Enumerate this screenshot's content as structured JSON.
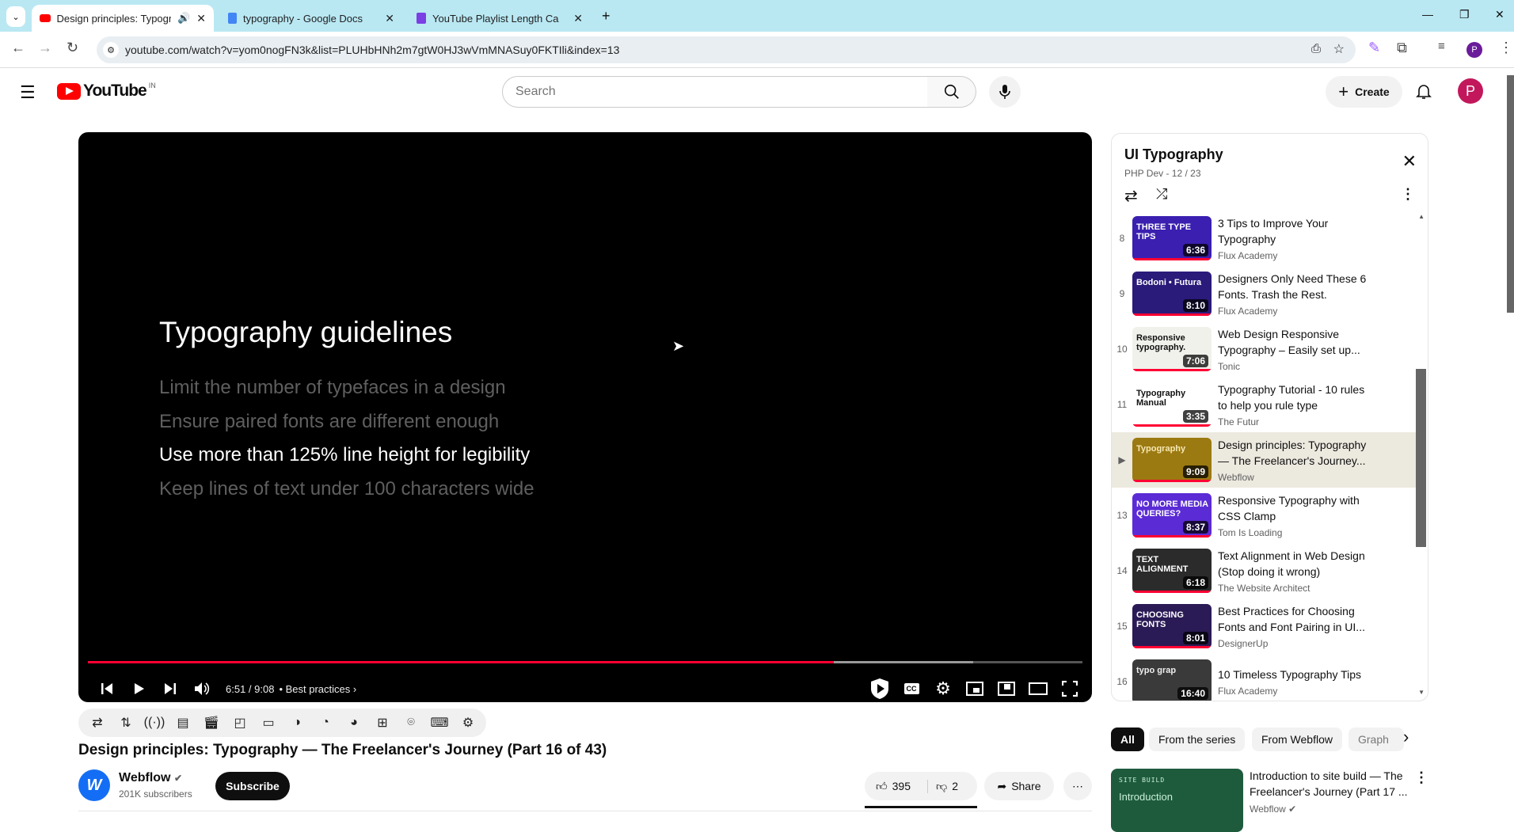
{
  "browser": {
    "tabs": [
      {
        "label": "Design principles: Typograp",
        "icon": "youtube-icon",
        "audio": true,
        "active": true
      },
      {
        "label": "typography - Google Docs",
        "icon": "docs-icon"
      },
      {
        "label": "YouTube Playlist Length Calcula",
        "icon": "calculator-icon"
      }
    ],
    "url": "youtube.com/watch?v=yom0nogFN3k&list=PLUHbHNh2m7gtW0HJ3wVmMNASuy0FKTIli&index=13"
  },
  "header": {
    "logo": "YouTube",
    "region": "IN",
    "search_placeholder": "Search",
    "create_label": "Create",
    "avatar_letter": "P",
    "avatar_color": "#c2185b"
  },
  "player": {
    "slide_title": "Typography guidelines",
    "slide_lines": [
      {
        "text": "Limit the number of typefaces in a design",
        "highlight": false
      },
      {
        "text": "Ensure paired fonts are different enough",
        "highlight": false
      },
      {
        "text": "Use more than 125% line height for legibility",
        "highlight": true
      },
      {
        "text": "Keep lines of text under 100 characters wide",
        "highlight": false
      }
    ],
    "time": "6:51 / 9:08",
    "chapter": "• Best practices",
    "played_fraction": 0.75,
    "buffered_fraction": 0.89,
    "accent": "#ff0033"
  },
  "video": {
    "title": "Design principles: Typography — The Freelancer's Journey (Part 16 of 43)",
    "channel": "Webflow",
    "subscribers": "201K subscribers",
    "subscribe_label": "Subscribe",
    "likes": "395",
    "dislikes": "2",
    "share_label": "Share"
  },
  "playlist": {
    "title": "UI Typography",
    "subtitle": "PHP Dev - 12 / 23",
    "items": [
      {
        "index": "8",
        "title": "3 Tips to Improve Your Typography",
        "channel": "Flux Academy",
        "duration": "6:36",
        "bg": "#3a1fb0",
        "thumb_text": "THREE TYPE TIPS",
        "thumb_color": "#fff"
      },
      {
        "index": "9",
        "title": "Designers Only Need These 6 Fonts. Trash the Rest.",
        "channel": "Flux Academy",
        "duration": "8:10",
        "bg": "#2a1a7a",
        "thumb_text": "Bodoni • Futura",
        "thumb_color": "#fff"
      },
      {
        "index": "10",
        "title": "Web Design Responsive Typography – Easily set up...",
        "channel": "Tonic",
        "duration": "7:06",
        "bg": "#f1f1ec",
        "thumb_text": "Responsive typography.",
        "thumb_color": "#111"
      },
      {
        "index": "11",
        "title": "Typography Tutorial - 10 rules to help you rule type",
        "channel": "The Futur",
        "duration": "3:35",
        "bg": "#ffffff",
        "thumb_text": "Typography Manual",
        "thumb_color": "#111"
      },
      {
        "index": "▶",
        "title": "Design principles: Typography — The Freelancer's Journey...",
        "channel": "Webflow",
        "duration": "9:09",
        "bg": "#9c7a12",
        "thumb_text": "Typography",
        "thumb_color": "#f5e7b0",
        "current": true
      },
      {
        "index": "13",
        "title": "Responsive Typography with CSS Clamp",
        "channel": "Tom Is Loading",
        "duration": "8:37",
        "bg": "#5b2bd6",
        "thumb_text": "NO MORE MEDIA QUERIES?",
        "thumb_color": "#fff"
      },
      {
        "index": "14",
        "title": "Text Alignment in Web Design (Stop doing it wrong)",
        "channel": "The Website Architect",
        "duration": "6:18",
        "bg": "#2b2b2b",
        "thumb_text": "TEXT ALIGNMENT",
        "thumb_color": "#fff"
      },
      {
        "index": "15",
        "title": "Best Practices for Choosing Fonts and Font Pairing in UI...",
        "channel": "DesignerUp",
        "duration": "8:01",
        "bg": "#2a1a55",
        "thumb_text": "CHOOSING FONTS",
        "thumb_color": "#fff"
      },
      {
        "index": "16",
        "title": "10 Timeless Typography Tips",
        "channel": "Flux Academy",
        "duration": "16:40",
        "bg": "#3a3a3a",
        "thumb_text": "typo grap",
        "thumb_color": "#eee"
      }
    ]
  },
  "chips": [
    "All",
    "From the series",
    "From Webflow",
    "Graph"
  ],
  "recommended": {
    "thumb_label": "SITE BUILD",
    "thumb_title": "Introduction",
    "title": "Introduction to site build — The Freelancer's Journey (Part 17 ...",
    "channel": "Webflow"
  }
}
